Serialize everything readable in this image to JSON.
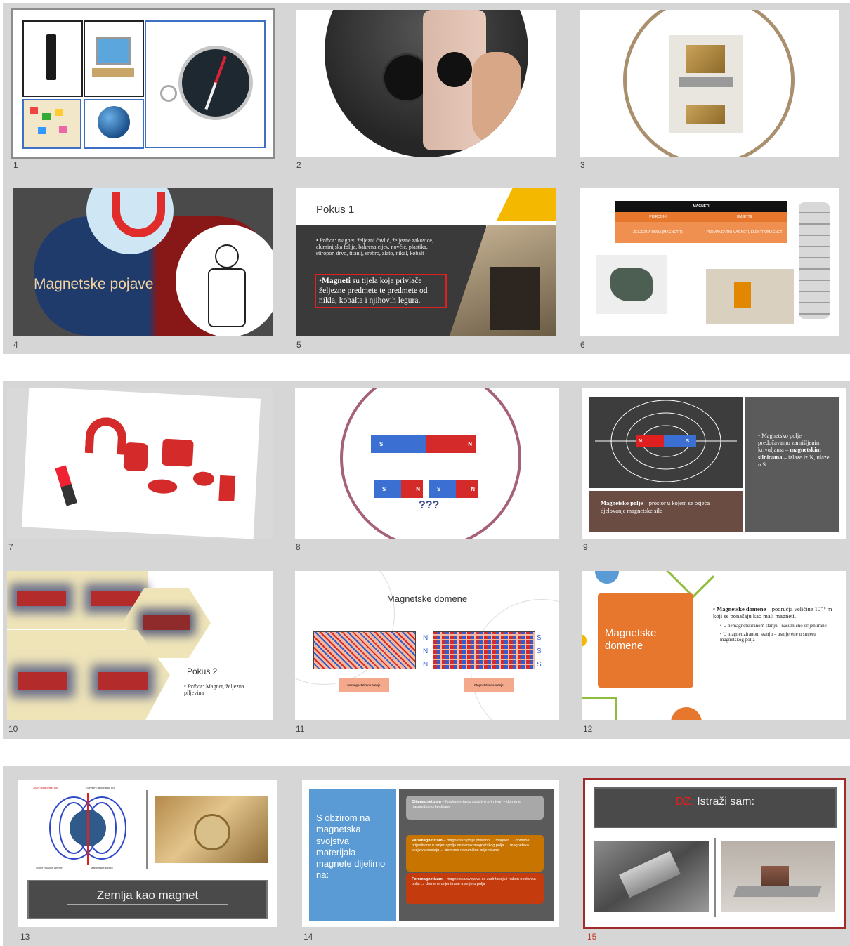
{
  "slides": [
    {
      "number": "1",
      "kind": "collage"
    },
    {
      "number": "2",
      "kind": "photo"
    },
    {
      "number": "3",
      "kind": "photo"
    },
    {
      "number": "4",
      "title": "Magnetske pojave"
    },
    {
      "number": "5",
      "title": "Pokus 1",
      "bullet1_label": "Pribor:",
      "bullet1_text": "magnet, željezni čavlić, željezne zakovice, aluminijska folija, bakrena cijev, novčić, plastika, stiropor, drvo, titanij, srebro, zlato, nikal, kobalt",
      "bullet2_bold": "Magneti",
      "bullet2_text": "su tijela koja privlače željezne predmete te predmete od nikla, kobalta i njihovih legura."
    },
    {
      "number": "6",
      "table_header": "MAGNETI",
      "col1": "PRIRODNI",
      "col2": "UMJETNI",
      "cell1": "ŽELJEZNA RUDA (MAGNETIT)",
      "cell2": "PERMANENTNI MAGNETI, ELEKTROMAGNET"
    },
    {
      "number": "7",
      "kind": "magnets"
    },
    {
      "number": "8",
      "label_s": "S",
      "label_n": "N",
      "question": "???"
    },
    {
      "number": "9",
      "label_n": "N",
      "label_s": "S",
      "field_bold": "Magnetsko polje",
      "field_text": "– prostor u kojem se osjeća djelovanje magnetske sile",
      "side_text_a": "Magnetsko polje predočavamo zamišljenim krivuljama –",
      "side_bold": "magnetskim silnicama",
      "side_text_b": "– izlaze iz N, ulaze u S"
    },
    {
      "number": "10",
      "title": "Pokus 2",
      "bullet_label": "Pribor:",
      "bullet_text": "Magnet, željezna piljevina"
    },
    {
      "number": "11",
      "title": "Magnetske domene",
      "label_n": "N",
      "label_s": "S",
      "state1": "Nemagnetizirano stanje",
      "state2": "Magnetizirano stanje"
    },
    {
      "number": "12",
      "box_title": "Magnetske domene",
      "bullet_bold": "Magnetske domene",
      "bullet_text": "– područja veličine 10⁻⁶ m koji se ponašaju kao mali magneti.",
      "sub1": "U nemagnetiziranom stanju - nasumično orijentirane",
      "sub2": "U magnetiziranom stanju – usmjerene u smjeru magnetskog polja"
    },
    {
      "number": "13",
      "title": "Zemlja kao magnet",
      "label_top_left": "Južni magnetski pol",
      "label_top_right": "Sjeverni geografski pol",
      "label_bottom_left": "Smjer rotacije Zemlje",
      "label_bottom_right": "Magnetske silnice"
    },
    {
      "number": "14",
      "left_text": "S obzirom na magnetska svojstva materijala magnete dijelimo na:",
      "item1_bold": "Dijamagnetizam",
      "item1_text": "– fundamentalno svojstvo svih tvari – domene nasumično orijentirane",
      "item2_bold": "Paramagnetizam",
      "item2_text": "– magnetsko polje prisutno → magneti → domene orijentirane u smjeru polja nestanak magnetskog polja → magnetska svojstva nestaju → domene nasumično orijentirane",
      "item3_bold": "Feromagnetizam",
      "item3_text": "– magnetska svojstva se zadržavaju i nakon nestanka polja → domene orijentirane u smjeru polja"
    },
    {
      "number": "15",
      "title_red": "DZ:",
      "title_rest": "Istraži sam:"
    }
  ],
  "colors": {
    "panel_bg": "#d6d6d6",
    "selected_outline": "#8c8c8c",
    "current_outline": "#a12b2b",
    "magnet_red": "#d42a2a",
    "magnet_blue": "#3b6fd1",
    "orange": "#e8772e",
    "dark_slide": "#3d3d3d"
  }
}
